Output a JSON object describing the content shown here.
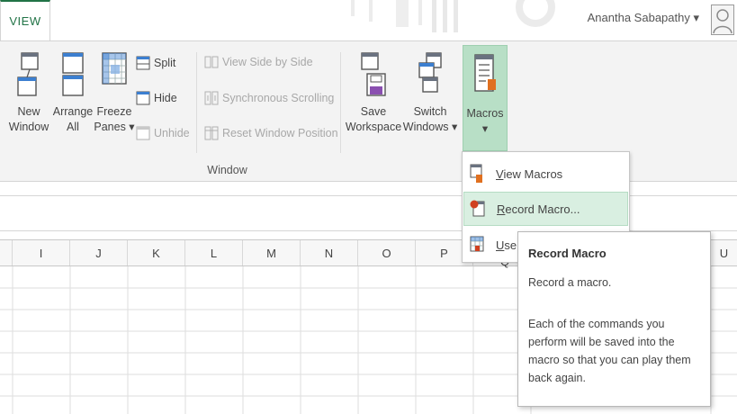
{
  "tabs": {
    "view": "VIEW"
  },
  "user": {
    "name": "Anantha Sabapathy ▾"
  },
  "ribbon": {
    "new_window": [
      "New",
      "Window"
    ],
    "arrange_all": [
      "Arrange",
      "All"
    ],
    "freeze_panes": [
      "Freeze",
      "Panes ▾"
    ],
    "split": "Split",
    "hide": "Hide",
    "unhide": "Unhide",
    "view_side_by_side": "View Side by Side",
    "synchronous_scrolling": "Synchronous Scrolling",
    "reset_window_position": "Reset Window Position",
    "save_workspace": [
      "Save",
      "Workspace"
    ],
    "switch_windows": [
      "Switch",
      "Windows ▾"
    ],
    "macros": [
      "Macros",
      "▾"
    ],
    "group_window_label": "Window"
  },
  "columns": [
    "I",
    "J",
    "K",
    "L",
    "M",
    "N",
    "O",
    "P",
    "Q",
    "U"
  ],
  "macro_menu": {
    "view_macros": {
      "accel": "V",
      "rest": "iew Macros"
    },
    "record_macro": {
      "accel": "R",
      "rest": "ecord Macro..."
    },
    "use_relative": {
      "accel": "U",
      "rest": "se"
    }
  },
  "tooltip": {
    "title": "Record Macro",
    "description": "Record a macro.",
    "detail": "Each of the commands you perform will be saved into the macro so that you can play them back again."
  },
  "colors": {
    "accent": "#217346",
    "macros_active_bg": "#b8dfc6",
    "menu_hover_bg": "#d9efe1"
  },
  "icons": {
    "new_window": "new-window-icon",
    "arrange_all": "arrange-all-icon",
    "freeze_panes": "freeze-panes-icon",
    "save_workspace": "save-workspace-icon",
    "switch_windows": "switch-windows-icon",
    "macros": "macros-icon"
  }
}
